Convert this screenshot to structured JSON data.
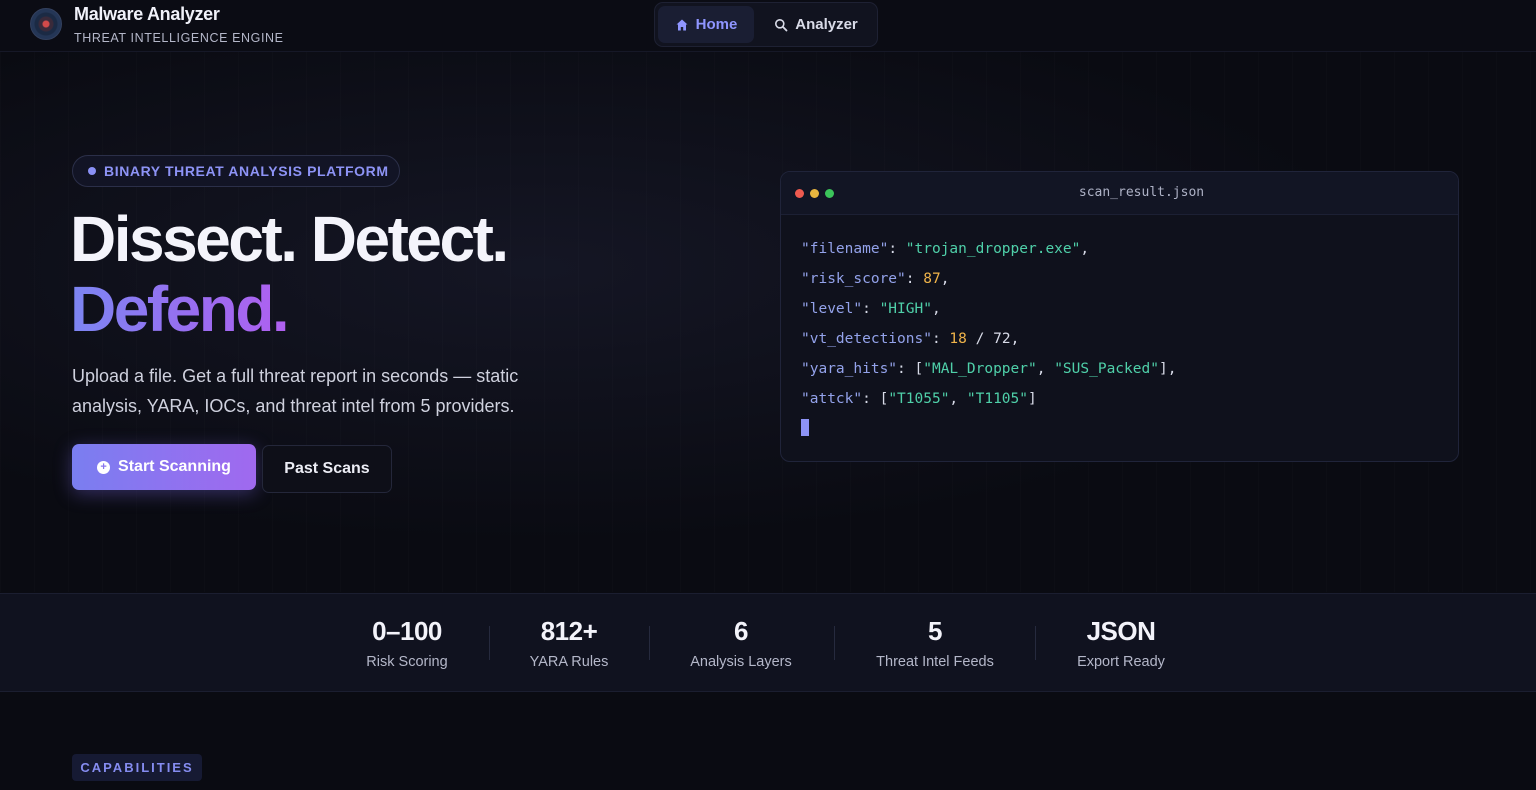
{
  "nav": {
    "brand_title": "Malware Analyzer",
    "brand_subtitle": "THREAT INTELLIGENCE ENGINE",
    "links": [
      {
        "label": "Home",
        "icon": "home-icon",
        "active": true
      },
      {
        "label": "Analyzer",
        "icon": "search-icon",
        "active": false
      }
    ]
  },
  "hero": {
    "badge": "BINARY THREAT ANALYSIS PLATFORM",
    "headline_line1": "Dissect. Detect.",
    "headline_line2": "Defend.",
    "lead": "Upload a file. Get a full threat report in seconds — static analysis, YARA, IOCs, and threat intel from 5 providers.",
    "primary_button": "Start Scanning",
    "secondary_button": "Past Scans"
  },
  "code_panel": {
    "filename": "scan_result.json",
    "fields": {
      "filename_key": "\"filename\"",
      "filename_val": "\"trojan_dropper.exe\"",
      "risk_key": "\"risk_score\"",
      "risk_val": "87",
      "level_key": "\"level\"",
      "level_val": "\"HIGH\"",
      "vt_key": "\"vt_detections\"",
      "vt_hits": "18",
      "vt_total": "72",
      "yara_key": "\"yara_hits\"",
      "yara_1": "\"MAL_Dropper\"",
      "yara_2": "\"SUS_Packed\"",
      "attck_key": "\"attck\"",
      "attck_1": "\"T1055\"",
      "attck_2": "\"T1105\""
    }
  },
  "stats": [
    {
      "value": "0–100",
      "label": "Risk Scoring"
    },
    {
      "value": "812+",
      "label": "YARA Rules"
    },
    {
      "value": "6",
      "label": "Analysis Layers"
    },
    {
      "value": "5",
      "label": "Threat Intel Feeds"
    },
    {
      "value": "JSON",
      "label": "Export Ready"
    }
  ],
  "section": {
    "capabilities_label": "CAPABILITIES"
  },
  "colors": {
    "accent": "#8d93f5",
    "gradient_start": "#7a7ef0",
    "gradient_end": "#a069ef",
    "string": "#4fd0a9",
    "number": "#f0b44a",
    "key": "#93a2ea",
    "window_red": "#ee5a4f",
    "window_yellow": "#e9b63f",
    "window_green": "#3bc45a"
  }
}
